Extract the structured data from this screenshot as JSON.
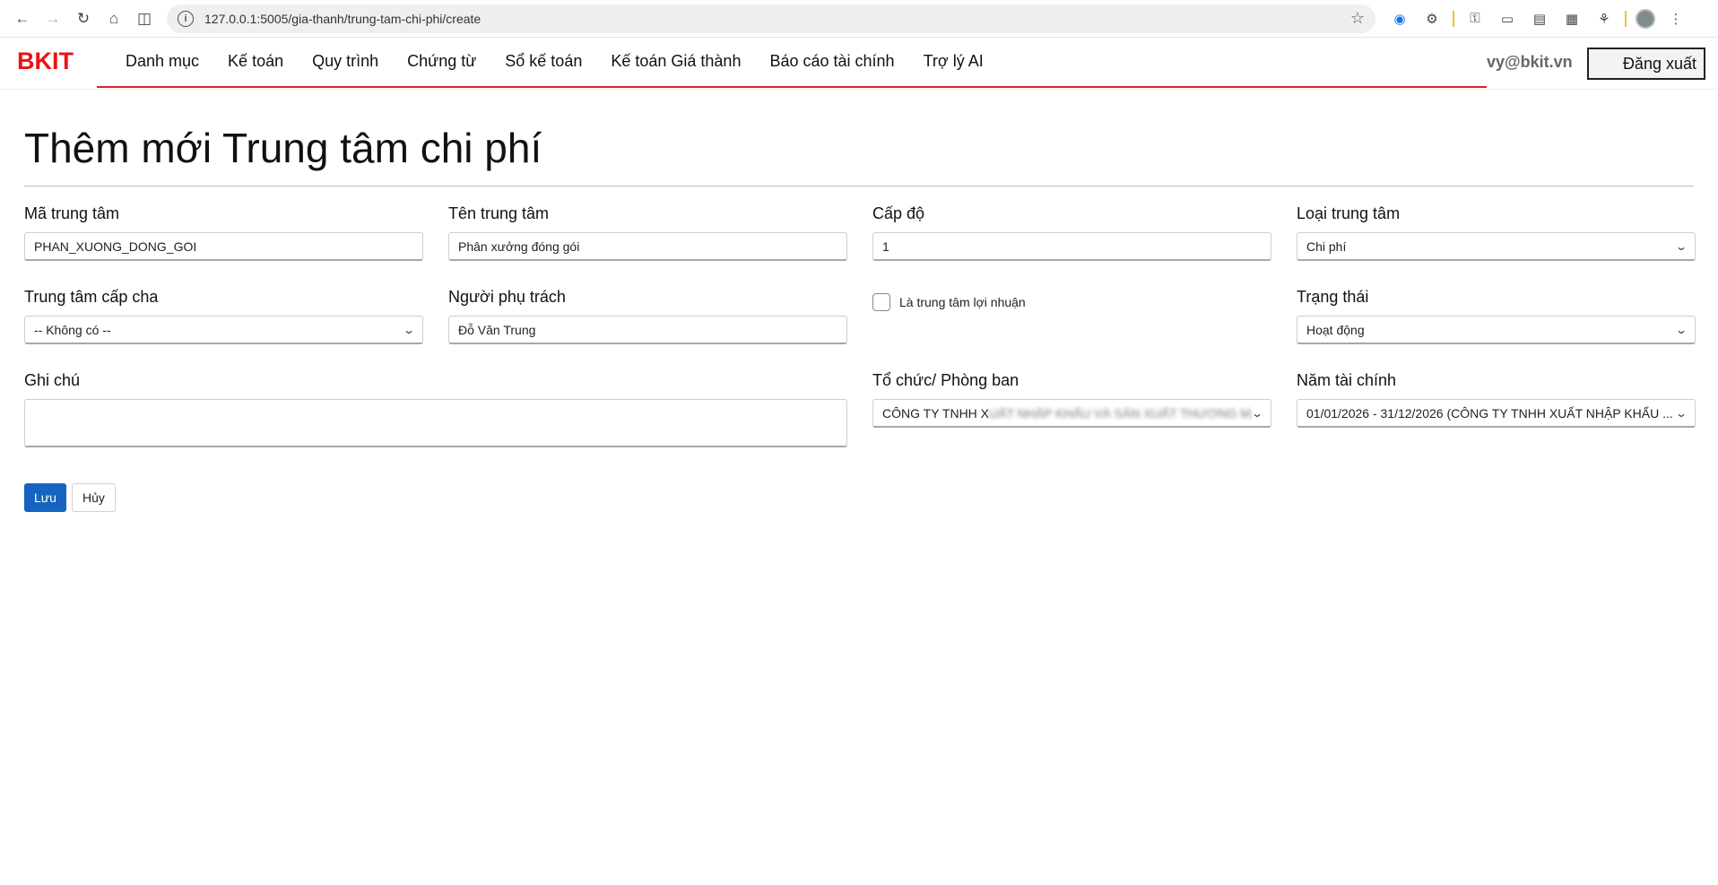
{
  "browser": {
    "url": "127.0.0.1:5005/gia-thanh/trung-tam-chi-phi/create"
  },
  "app": {
    "brand": "BKIT",
    "menu": [
      "Danh mục",
      "Kế toán",
      "Quy trình",
      "Chứng từ",
      "Sổ kế toán",
      "Kế toán Giá thành",
      "Báo cáo tài chính",
      "Trợ lý AI"
    ],
    "user": "vy@bkit.vn",
    "logout_label": "Đăng xuất"
  },
  "page": {
    "title": "Thêm mới Trung tâm chi phí"
  },
  "form": {
    "ma_trung_tam": {
      "label": "Mã trung tâm",
      "value": "PHAN_XUONG_DONG_GOI"
    },
    "ten_trung_tam": {
      "label": "Tên trung tâm",
      "value": "Phân xưởng đóng gói"
    },
    "cap_do": {
      "label": "Cấp độ",
      "value": "1"
    },
    "loai_trung_tam": {
      "label": "Loại trung tâm",
      "value": "Chi phí"
    },
    "trung_tam_cap_cha": {
      "label": "Trung tâm cấp cha",
      "value": "-- Không có --"
    },
    "nguoi_phu_trach": {
      "label": "Người phụ trách",
      "value": "Đỗ Văn Trung"
    },
    "la_trung_tam_loi_nhuan": {
      "label": "Là trung tâm lợi nhuận",
      "checked": false
    },
    "trang_thai": {
      "label": "Trạng thái",
      "value": "Hoạt động"
    },
    "ghi_chu": {
      "label": "Ghi chú",
      "value": ""
    },
    "to_chuc": {
      "label": "Tổ chức/ Phòng ban",
      "value_visible": "CÔNG TY TNHH X",
      "value_blurred": "UẤT NHẬP KHẨU VÀ SẢN XUẤT THƯƠNG M..."
    },
    "nam_tai_chinh": {
      "label": "Năm tài chính",
      "value": "01/01/2026 - 31/12/2026 (CÔNG TY TNHH XUẤT NHẬP KHẨU ..."
    }
  },
  "actions": {
    "save_label": "Lưu",
    "cancel_label": "Hủy"
  },
  "colors": {
    "brand": "#ee1111",
    "nav_underline": "#e02020",
    "primary_button": "#1565c0"
  }
}
